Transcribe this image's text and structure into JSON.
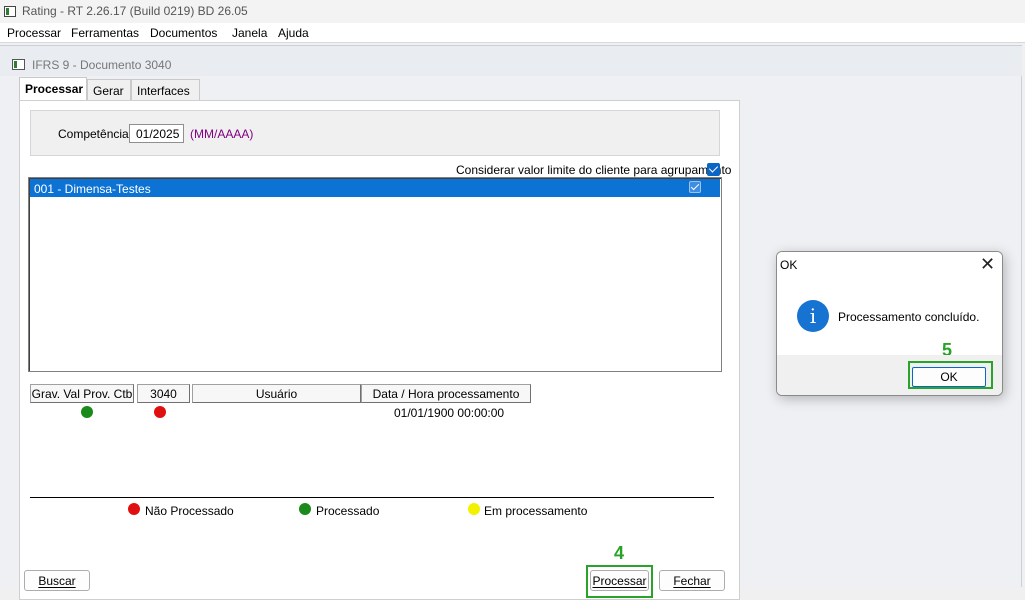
{
  "window": {
    "title": "Rating - RT 2.26.17 (Build 0219) BD 26.05"
  },
  "menu": [
    "Processar",
    "Ferramentas",
    "Documentos",
    "Janela",
    "Ajuda"
  ],
  "child_window": {
    "title": "IFRS 9 - Documento 3040"
  },
  "tabs": [
    "Processar",
    "Gerar",
    "Interfaces"
  ],
  "competencia": {
    "label": "Competência",
    "value": "01/2025",
    "format": "(MM/AAAA)"
  },
  "agrupamento": {
    "label": "Considerar valor limite do cliente para agrupamento",
    "checked": true
  },
  "list": {
    "items": [
      {
        "label": "001 - Dimensa-Testes",
        "checked": true,
        "selected": true
      }
    ]
  },
  "status_table": {
    "headers": [
      "Grav. Val Prov. Ctb",
      "3040",
      "Usuário",
      "Data / Hora processamento"
    ],
    "row": {
      "grav_status": "processado",
      "doc_status": "nao-processado",
      "usuario": "",
      "data_hora": "01/01/1900 00:00:00"
    }
  },
  "legend": [
    {
      "label": "Não Processado",
      "color": "#e01010"
    },
    {
      "label": "Processado",
      "color": "#1a8a1a"
    },
    {
      "label": "Em processamento",
      "color": "#f2f200"
    }
  ],
  "buttons": {
    "buscar": "Buscar",
    "processar": "Processar",
    "fechar": "Fechar"
  },
  "annotations": {
    "step_processar": "4",
    "step_ok": "5",
    "color": "#2aa32a"
  },
  "dialog": {
    "title": "OK",
    "message": "Processamento concluído.",
    "ok_label": "OK",
    "close": "✕"
  }
}
